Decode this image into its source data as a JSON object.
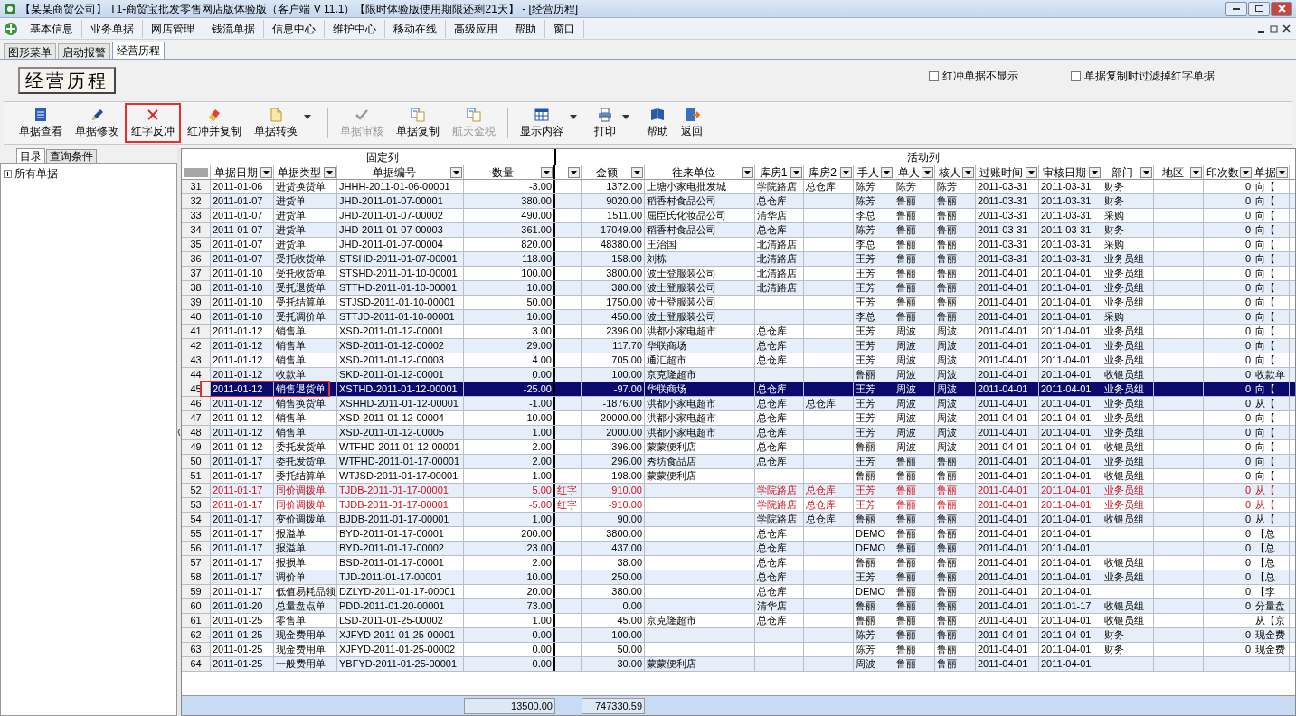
{
  "window": {
    "title": "【某某商贸公司】 T1-商贸宝批发零售网店版体验版（客户端 V 11.1）【限时体验版使用期限还剩21天】 - [经营历程]"
  },
  "menu": [
    "基本信息",
    "业务单据",
    "网店管理",
    "钱流单据",
    "信息中心",
    "维护中心",
    "移动在线",
    "高级应用",
    "帮助",
    "窗口"
  ],
  "tabs": [
    {
      "label": "图形菜单",
      "selected": false
    },
    {
      "label": "启动报警",
      "selected": false
    },
    {
      "label": "经营历程",
      "selected": true
    }
  ],
  "page_title": "经营历程",
  "options": [
    {
      "label": "红冲单据不显示",
      "checked": false
    },
    {
      "label": "单据复制时过滤掉红字单据",
      "checked": false
    }
  ],
  "toolbar": [
    {
      "label": "单据查看",
      "disabled": false,
      "dropdown": false,
      "annotated": false
    },
    {
      "label": "单据修改",
      "disabled": false,
      "dropdown": false,
      "annotated": false
    },
    {
      "label": "红字反冲",
      "disabled": false,
      "dropdown": false,
      "annotated": true
    },
    {
      "label": "红冲并复制",
      "disabled": false,
      "dropdown": false,
      "annotated": false
    },
    {
      "label": "单据转换",
      "disabled": false,
      "dropdown": true,
      "annotated": false
    },
    {
      "kind": "separator"
    },
    {
      "label": "单据审核",
      "disabled": true,
      "dropdown": false,
      "annotated": false
    },
    {
      "label": "单据复制",
      "disabled": false,
      "dropdown": false,
      "annotated": false
    },
    {
      "label": "航天金税",
      "disabled": true,
      "dropdown": false,
      "annotated": false
    },
    {
      "kind": "separator"
    },
    {
      "label": "显示内容",
      "disabled": false,
      "dropdown": true,
      "annotated": false
    },
    {
      "label": "打印",
      "disabled": false,
      "dropdown": true,
      "annotated": false
    },
    {
      "label": "帮助",
      "disabled": false,
      "dropdown": false,
      "annotated": false
    },
    {
      "label": "返回",
      "disabled": false,
      "dropdown": false,
      "annotated": false
    }
  ],
  "side_tabs": [
    {
      "label": "目录",
      "selected": true
    },
    {
      "label": "查询条件",
      "selected": false
    }
  ],
  "tree": [
    {
      "label": "所有单据",
      "expanded": false
    }
  ],
  "table": {
    "groups": [
      "固定列",
      "活动列"
    ],
    "columns": [
      "",
      "单据日期",
      "单据类型",
      "单据编号",
      "数量",
      "",
      "金额",
      "往来单位",
      "库房1",
      "库房2",
      "手人",
      "单人",
      "核人",
      "过账时间",
      "审核日期",
      "部门",
      "地区",
      "印次数",
      "单据"
    ],
    "rows": [
      {
        "cells": [
          "31",
          "2011-01-06",
          "进货换货单",
          "JHHH-2011-01-06-00001",
          "-3.00",
          "",
          "1372.00",
          "上塘小家电批发城",
          "学院路店",
          "总仓库",
          "陈芳",
          "陈芳",
          "陈芳",
          "2011-03-31",
          "2011-03-31",
          "财务",
          "",
          "0",
          "向【"
        ],
        "red": false,
        "selected": false,
        "annotated": false
      },
      {
        "cells": [
          "32",
          "2011-01-07",
          "进货单",
          "JHD-2011-01-07-00001",
          "380.00",
          "",
          "9020.00",
          "稻香村食品公司",
          "总仓库",
          "",
          "陈芳",
          "鲁丽",
          "鲁丽",
          "2011-03-31",
          "2011-03-31",
          "财务",
          "",
          "0",
          "向【"
        ],
        "red": false,
        "selected": false,
        "annotated": false
      },
      {
        "cells": [
          "33",
          "2011-01-07",
          "进货单",
          "JHD-2011-01-07-00002",
          "490.00",
          "",
          "1511.00",
          "屈臣氏化妆品公司",
          "清华店",
          "",
          "李总",
          "鲁丽",
          "鲁丽",
          "2011-03-31",
          "2011-03-31",
          "采购",
          "",
          "0",
          "向【"
        ],
        "red": false,
        "selected": false,
        "annotated": false
      },
      {
        "cells": [
          "34",
          "2011-01-07",
          "进货单",
          "JHD-2011-01-07-00003",
          "361.00",
          "",
          "17049.00",
          "稻香村食品公司",
          "总仓库",
          "",
          "陈芳",
          "鲁丽",
          "鲁丽",
          "2011-03-31",
          "2011-03-31",
          "财务",
          "",
          "0",
          "向【"
        ],
        "red": false,
        "selected": false,
        "annotated": false
      },
      {
        "cells": [
          "35",
          "2011-01-07",
          "进货单",
          "JHD-2011-01-07-00004",
          "820.00",
          "",
          "48380.00",
          "王治国",
          "北清路店",
          "",
          "李总",
          "鲁丽",
          "鲁丽",
          "2011-03-31",
          "2011-03-31",
          "采购",
          "",
          "0",
          "向【"
        ],
        "red": false,
        "selected": false,
        "annotated": false
      },
      {
        "cells": [
          "36",
          "2011-01-07",
          "受托收货单",
          "STSHD-2011-01-07-00001",
          "118.00",
          "",
          "158.00",
          "刘栋",
          "北清路店",
          "",
          "王芳",
          "鲁丽",
          "鲁丽",
          "2011-03-31",
          "2011-03-31",
          "业务员组",
          "",
          "0",
          "向【"
        ],
        "red": false,
        "selected": false,
        "annotated": false
      },
      {
        "cells": [
          "37",
          "2011-01-10",
          "受托收货单",
          "STSHD-2011-01-10-00001",
          "100.00",
          "",
          "3800.00",
          "波士登服装公司",
          "北清路店",
          "",
          "王芳",
          "鲁丽",
          "鲁丽",
          "2011-04-01",
          "2011-04-01",
          "业务员组",
          "",
          "0",
          "向【"
        ],
        "red": false,
        "selected": false,
        "annotated": false
      },
      {
        "cells": [
          "38",
          "2011-01-10",
          "受托退货单",
          "STTHD-2011-01-10-00001",
          "10.00",
          "",
          "380.00",
          "波士登服装公司",
          "北清路店",
          "",
          "王芳",
          "鲁丽",
          "鲁丽",
          "2011-04-01",
          "2011-04-01",
          "业务员组",
          "",
          "0",
          "向【"
        ],
        "red": false,
        "selected": false,
        "annotated": false
      },
      {
        "cells": [
          "39",
          "2011-01-10",
          "受托结算单",
          "STJSD-2011-01-10-00001",
          "50.00",
          "",
          "1750.00",
          "波士登服装公司",
          "",
          "",
          "王芳",
          "鲁丽",
          "鲁丽",
          "2011-04-01",
          "2011-04-01",
          "业务员组",
          "",
          "0",
          "向【"
        ],
        "red": false,
        "selected": false,
        "annotated": false
      },
      {
        "cells": [
          "40",
          "2011-01-10",
          "受托调价单",
          "STTJD-2011-01-10-00001",
          "10.00",
          "",
          "450.00",
          "波士登服装公司",
          "",
          "",
          "李总",
          "鲁丽",
          "鲁丽",
          "2011-04-01",
          "2011-04-01",
          "采购",
          "",
          "0",
          "向【"
        ],
        "red": false,
        "selected": false,
        "annotated": false
      },
      {
        "cells": [
          "41",
          "2011-01-12",
          "销售单",
          "XSD-2011-01-12-00001",
          "3.00",
          "",
          "2396.00",
          "洪都小家电超市",
          "总仓库",
          "",
          "王芳",
          "周波",
          "周波",
          "2011-04-01",
          "2011-04-01",
          "业务员组",
          "",
          "0",
          "向【"
        ],
        "red": false,
        "selected": false,
        "annotated": false
      },
      {
        "cells": [
          "42",
          "2011-01-12",
          "销售单",
          "XSD-2011-01-12-00002",
          "29.00",
          "",
          "117.70",
          "华联商场",
          "总仓库",
          "",
          "王芳",
          "周波",
          "周波",
          "2011-04-01",
          "2011-04-01",
          "业务员组",
          "",
          "0",
          "向【"
        ],
        "red": false,
        "selected": false,
        "annotated": false
      },
      {
        "cells": [
          "43",
          "2011-01-12",
          "销售单",
          "XSD-2011-01-12-00003",
          "4.00",
          "",
          "705.00",
          "通汇超市",
          "总仓库",
          "",
          "王芳",
          "周波",
          "周波",
          "2011-04-01",
          "2011-04-01",
          "业务员组",
          "",
          "0",
          "向【"
        ],
        "red": false,
        "selected": false,
        "annotated": false
      },
      {
        "cells": [
          "44",
          "2011-01-12",
          "收款单",
          "SKD-2011-01-12-00001",
          "0.00",
          "",
          "100.00",
          "京克隆超市",
          "",
          "",
          "鲁丽",
          "周波",
          "周波",
          "2011-04-01",
          "2011-04-01",
          "收银员组",
          "",
          "0",
          "收款单"
        ],
        "red": false,
        "selected": false,
        "annotated": false
      },
      {
        "cells": [
          "45",
          "2011-01-12",
          "销售退货单",
          "XSTHD-2011-01-12-00001",
          "-25.00",
          "",
          "-97.00",
          "华联商场",
          "总仓库",
          "",
          "王芳",
          "周波",
          "周波",
          "2011-04-01",
          "2011-04-01",
          "业务员组",
          "",
          "0",
          "向【"
        ],
        "red": false,
        "selected": true,
        "annotated": true
      },
      {
        "cells": [
          "46",
          "2011-01-12",
          "销售换货单",
          "XSHHD-2011-01-12-00001",
          "-1.00",
          "",
          "-1876.00",
          "洪都小家电超市",
          "总仓库",
          "总仓库",
          "王芳",
          "周波",
          "周波",
          "2011-04-01",
          "2011-04-01",
          "业务员组",
          "",
          "0",
          "从【"
        ],
        "red": false,
        "selected": false,
        "annotated": false
      },
      {
        "cells": [
          "47",
          "2011-01-12",
          "销售单",
          "XSD-2011-01-12-00004",
          "10.00",
          "",
          "20000.00",
          "洪都小家电超市",
          "总仓库",
          "",
          "王芳",
          "周波",
          "周波",
          "2011-04-01",
          "2011-04-01",
          "业务员组",
          "",
          "0",
          "向【"
        ],
        "red": false,
        "selected": false,
        "annotated": false
      },
      {
        "cells": [
          "48",
          "2011-01-12",
          "销售单",
          "XSD-2011-01-12-00005",
          "1.00",
          "",
          "2000.00",
          "洪都小家电超市",
          "总仓库",
          "",
          "王芳",
          "周波",
          "周波",
          "2011-04-01",
          "2011-04-01",
          "业务员组",
          "",
          "0",
          "向【"
        ],
        "red": false,
        "selected": false,
        "annotated": false
      },
      {
        "cells": [
          "49",
          "2011-01-12",
          "委托发货单",
          "WTFHD-2011-01-12-00001",
          "2.00",
          "",
          "396.00",
          "蒙蒙便利店",
          "总仓库",
          "",
          "鲁丽",
          "周波",
          "周波",
          "2011-04-01",
          "2011-04-01",
          "收银员组",
          "",
          "0",
          "向【"
        ],
        "red": false,
        "selected": false,
        "annotated": false
      },
      {
        "cells": [
          "50",
          "2011-01-17",
          "委托发货单",
          "WTFHD-2011-01-17-00001",
          "2.00",
          "",
          "296.00",
          "秀坊食品店",
          "总仓库",
          "",
          "王芳",
          "鲁丽",
          "鲁丽",
          "2011-04-01",
          "2011-04-01",
          "业务员组",
          "",
          "0",
          "向【"
        ],
        "red": false,
        "selected": false,
        "annotated": false
      },
      {
        "cells": [
          "51",
          "2011-01-17",
          "委托结算单",
          "WTJSD-2011-01-17-00001",
          "1.00",
          "",
          "198.00",
          "蒙蒙便利店",
          "",
          "",
          "鲁丽",
          "鲁丽",
          "鲁丽",
          "2011-04-01",
          "2011-04-01",
          "收银员组",
          "",
          "0",
          "向【"
        ],
        "red": false,
        "selected": false,
        "annotated": false
      },
      {
        "cells": [
          "52",
          "2011-01-17",
          "同价调拨单",
          "TJDB-2011-01-17-00001",
          "5.00",
          "红字",
          "910.00",
          "",
          "学院路店",
          "总仓库",
          "王芳",
          "鲁丽",
          "鲁丽",
          "2011-04-01",
          "2011-04-01",
          "业务员组",
          "",
          "0",
          "从【"
        ],
        "red": true,
        "selected": false,
        "annotated": false
      },
      {
        "cells": [
          "53",
          "2011-01-17",
          "同价调拨单",
          "TJDB-2011-01-17-00001",
          "-5.00",
          "红字",
          "-910.00",
          "",
          "学院路店",
          "总仓库",
          "王芳",
          "鲁丽",
          "鲁丽",
          "2011-04-01",
          "2011-04-01",
          "业务员组",
          "",
          "0",
          "从【"
        ],
        "red": true,
        "selected": false,
        "annotated": false
      },
      {
        "cells": [
          "54",
          "2011-01-17",
          "变价调拨单",
          "BJDB-2011-01-17-00001",
          "1.00",
          "",
          "90.00",
          "",
          "学院路店",
          "总仓库",
          "鲁丽",
          "鲁丽",
          "鲁丽",
          "2011-04-01",
          "2011-04-01",
          "收银员组",
          "",
          "0",
          "从【"
        ],
        "red": false,
        "selected": false,
        "annotated": false
      },
      {
        "cells": [
          "55",
          "2011-01-17",
          "报溢单",
          "BYD-2011-01-17-00001",
          "200.00",
          "",
          "3800.00",
          "",
          "总仓库",
          "",
          "DEMO",
          "鲁丽",
          "鲁丽",
          "2011-04-01",
          "2011-04-01",
          "",
          "",
          "0",
          "【总"
        ],
        "red": false,
        "selected": false,
        "annotated": false
      },
      {
        "cells": [
          "56",
          "2011-01-17",
          "报溢单",
          "BYD-2011-01-17-00002",
          "23.00",
          "",
          "437.00",
          "",
          "总仓库",
          "",
          "DEMO",
          "鲁丽",
          "鲁丽",
          "2011-04-01",
          "2011-04-01",
          "",
          "",
          "0",
          "【总"
        ],
        "red": false,
        "selected": false,
        "annotated": false
      },
      {
        "cells": [
          "57",
          "2011-01-17",
          "报损单",
          "BSD-2011-01-17-00001",
          "2.00",
          "",
          "38.00",
          "",
          "总仓库",
          "",
          "鲁丽",
          "鲁丽",
          "鲁丽",
          "2011-04-01",
          "2011-04-01",
          "收银员组",
          "",
          "0",
          "【总"
        ],
        "red": false,
        "selected": false,
        "annotated": false
      },
      {
        "cells": [
          "58",
          "2011-01-17",
          "调价单",
          "TJD-2011-01-17-00001",
          "10.00",
          "",
          "250.00",
          "",
          "总仓库",
          "",
          "王芳",
          "鲁丽",
          "鲁丽",
          "2011-04-01",
          "2011-04-01",
          "业务员组",
          "",
          "0",
          "【总"
        ],
        "red": false,
        "selected": false,
        "annotated": false
      },
      {
        "cells": [
          "59",
          "2011-01-17",
          "低值易耗品领",
          "DZLYD-2011-01-17-00001",
          "20.00",
          "",
          "380.00",
          "",
          "总仓库",
          "",
          "DEMO",
          "鲁丽",
          "鲁丽",
          "2011-04-01",
          "2011-04-01",
          "",
          "",
          "0",
          "【李"
        ],
        "red": false,
        "selected": false,
        "annotated": false
      },
      {
        "cells": [
          "60",
          "2011-01-20",
          "总量盘点单",
          "PDD-2011-01-20-00001",
          "73.00",
          "",
          "0.00",
          "",
          "清华店",
          "",
          "鲁丽",
          "鲁丽",
          "鲁丽",
          "2011-04-01",
          "2011-01-17",
          "收银员组",
          "",
          "0",
          "分量盘"
        ],
        "red": false,
        "selected": false,
        "annotated": false
      },
      {
        "cells": [
          "61",
          "2011-01-25",
          "零售单",
          "LSD-2011-01-25-00002",
          "1.00",
          "",
          "45.00",
          "京克隆超市",
          "总仓库",
          "",
          "鲁丽",
          "鲁丽",
          "鲁丽",
          "2011-04-01",
          "2011-04-01",
          "收银员组",
          "",
          "",
          "从【京"
        ],
        "red": false,
        "selected": false,
        "annotated": false
      },
      {
        "cells": [
          "62",
          "2011-01-25",
          "现金费用单",
          "XJFYD-2011-01-25-00001",
          "0.00",
          "",
          "100.00",
          "",
          "",
          "",
          "陈芳",
          "鲁丽",
          "鲁丽",
          "2011-04-01",
          "2011-04-01",
          "财务",
          "",
          "0",
          "现金费"
        ],
        "red": false,
        "selected": false,
        "annotated": false
      },
      {
        "cells": [
          "63",
          "2011-01-25",
          "现金费用单",
          "XJFYD-2011-01-25-00002",
          "0.00",
          "",
          "50.00",
          "",
          "",
          "",
          "陈芳",
          "鲁丽",
          "鲁丽",
          "2011-04-01",
          "2011-04-01",
          "财务",
          "",
          "0",
          "现金费"
        ],
        "red": false,
        "selected": false,
        "annotated": false
      },
      {
        "cells": [
          "64",
          "2011-01-25",
          "一般费用单",
          "YBFYD-2011-01-25-00001",
          "0.00",
          "",
          "30.00",
          "蒙蒙便利店",
          "",
          "",
          "周波",
          "鲁丽",
          "鲁丽",
          "2011-04-01",
          "2011-04-01",
          "",
          "",
          "",
          ""
        ],
        "red": false,
        "selected": false,
        "annotated": false
      }
    ],
    "totals": {
      "quantity": "13500.00",
      "amount": "747330.59"
    }
  }
}
